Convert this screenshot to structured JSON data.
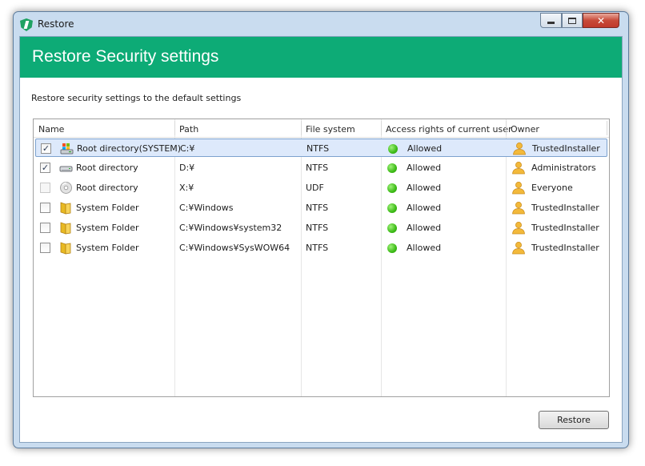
{
  "window": {
    "title": "Restore",
    "controls": {
      "minimize": "minimize",
      "maximize": "maximize",
      "close": "✕"
    }
  },
  "banner": {
    "title": "Restore Security settings"
  },
  "description": "Restore security settings to the default settings",
  "table": {
    "columns": [
      "Name",
      "Path",
      "File system",
      "Access rights of current user",
      "Owner"
    ],
    "rows": [
      {
        "checked": true,
        "enabled": true,
        "icon": "system-drive-icon",
        "name": "Root directory(SYSTEM)",
        "path": "C:¥",
        "fs": "NTFS",
        "access": "Allowed",
        "owner": "TrustedInstaller",
        "selected": true
      },
      {
        "checked": true,
        "enabled": true,
        "icon": "hard-drive-icon",
        "name": "Root directory",
        "path": "D:¥",
        "fs": "NTFS",
        "access": "Allowed",
        "owner": "Administrators"
      },
      {
        "checked": false,
        "enabled": false,
        "icon": "optical-disc-icon",
        "name": "Root directory",
        "path": "X:¥",
        "fs": "UDF",
        "access": "Allowed",
        "owner": "Everyone"
      },
      {
        "checked": false,
        "enabled": true,
        "icon": "folder-icon",
        "name": "System Folder",
        "path": "C:¥Windows",
        "fs": "NTFS",
        "access": "Allowed",
        "owner": "TrustedInstaller"
      },
      {
        "checked": false,
        "enabled": true,
        "icon": "folder-icon",
        "name": "System Folder",
        "path": "C:¥Windows¥system32",
        "fs": "NTFS",
        "access": "Allowed",
        "owner": "TrustedInstaller"
      },
      {
        "checked": false,
        "enabled": true,
        "icon": "folder-icon",
        "name": "System Folder",
        "path": "C:¥Windows¥SysWOW64",
        "fs": "NTFS",
        "access": "Allowed",
        "owner": "TrustedInstaller"
      }
    ]
  },
  "restore_button": "Restore",
  "colors": {
    "banner": "#0dab76",
    "allowed": "#3dbb17",
    "selection": "#dde9fb"
  }
}
